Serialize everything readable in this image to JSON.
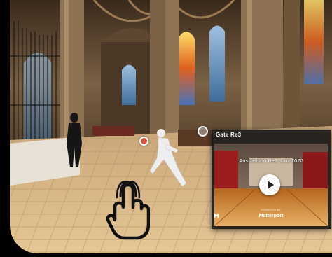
{
  "tour": {
    "scene": "church-interior-panorama",
    "hand_icon": "tap-hand-icon"
  },
  "panel": {
    "title": "Gate Re3",
    "caption": "Ausstellung Re3, Linz 2020",
    "play_icon": "play-icon",
    "powered_by": "POWERED BY",
    "brand": "Matterport",
    "brand_icon": "matterport-logo"
  },
  "colors": {
    "panel_bg": "#1a1a1a",
    "floor": "#d8b585",
    "walls": "#6b5338",
    "windows": "#6a8fb8",
    "play_button": "#ffffff"
  }
}
